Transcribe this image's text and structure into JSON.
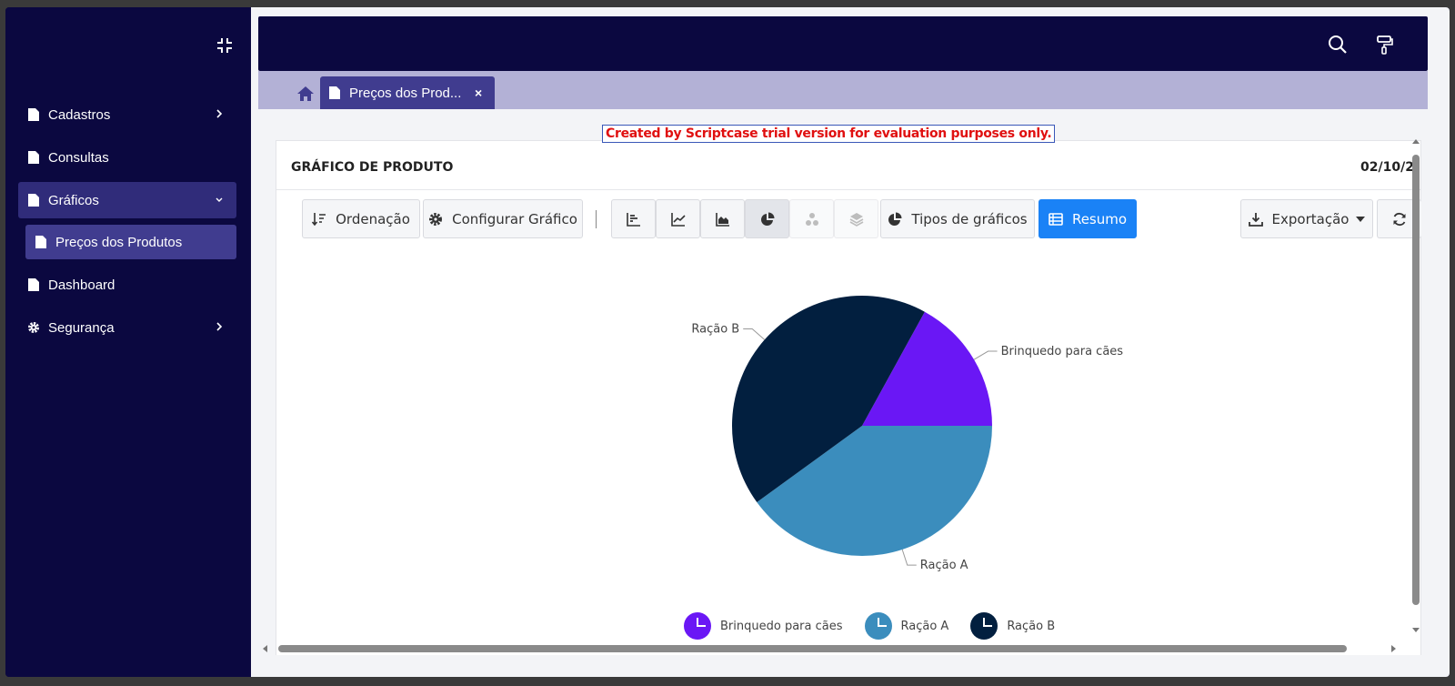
{
  "sidebar": {
    "items": [
      {
        "label": "Cadastros"
      },
      {
        "label": "Consultas"
      },
      {
        "label": "Gráficos"
      },
      {
        "label": "Preços dos Produtos"
      },
      {
        "label": "Dashboard"
      },
      {
        "label": "Segurança"
      }
    ]
  },
  "tabs": [
    {
      "label": "Preços dos Prod...",
      "close": "×"
    }
  ],
  "trial_notice": "Created by Scriptcase trial version for evaluation purposes only.",
  "panel": {
    "title": "GRÁFICO DE PRODUTO",
    "date": "02/10/2"
  },
  "toolbar": {
    "sort_label": "Ordenação",
    "config_label": "Configurar Gráfico",
    "chart_types_label": "Tipos de gráficos",
    "summary_label": "Resumo",
    "export_label": "Exportação"
  },
  "icons": {
    "collapse": "compress-icon",
    "search": "search-icon",
    "theme": "paint-roller-icon",
    "home": "home-icon",
    "file": "file-icon",
    "gear": "gear-icon",
    "bar": "bar-chart-icon",
    "line": "line-chart-icon",
    "area": "area-chart-icon",
    "pie": "pie-chart-icon",
    "bubble": "bubble-chart-icon",
    "stack": "layers-icon",
    "table": "table-icon",
    "download": "download-icon",
    "refresh": "refresh-icon"
  },
  "colors": {
    "sidebar_bg": "#0b0840",
    "tab_bg": "#403c8f",
    "primary": "#1a82f6",
    "trial_text": "#e01010"
  },
  "chart_data": {
    "type": "pie",
    "title": "",
    "categories": [
      "Brinquedo para cães",
      "Ração A",
      "Ração B"
    ],
    "values": [
      17,
      40,
      43
    ],
    "colors": [
      "#6a17f5",
      "#3b8dbd",
      "#021f3f"
    ],
    "legend": "bottom"
  }
}
